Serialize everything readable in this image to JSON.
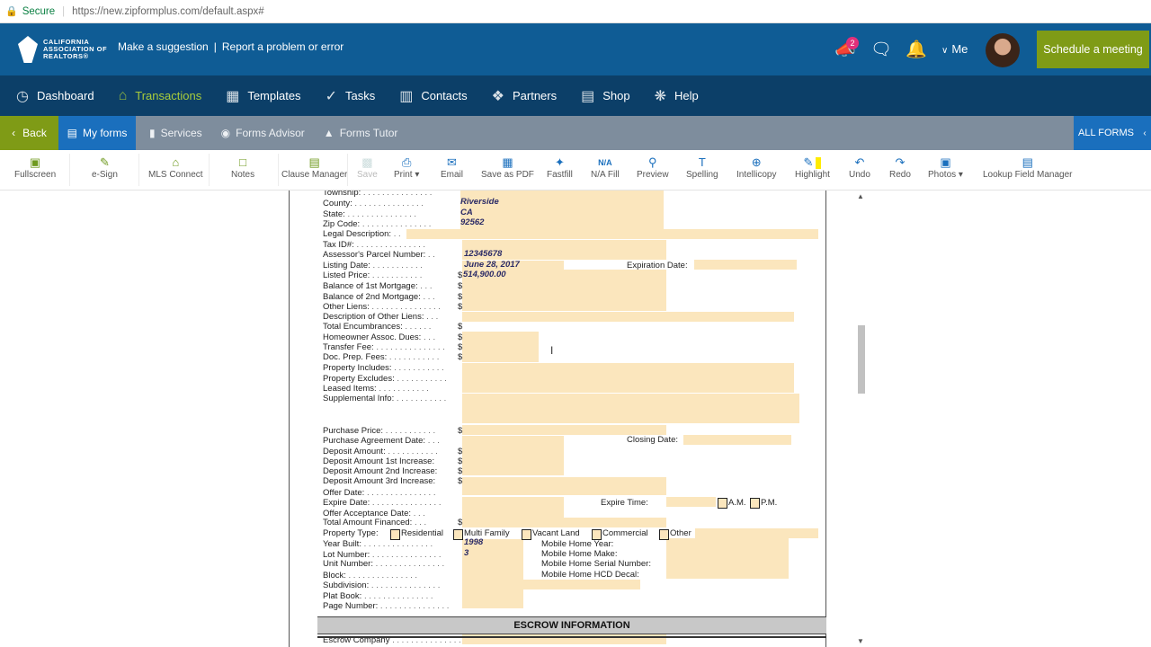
{
  "browser": {
    "secure_label": "Secure",
    "url": "https://new.zipformplus.com/default.aspx#"
  },
  "header": {
    "logo_text": "CALIFORNIA ASSOCIATION OF REALTORS®",
    "suggestion_link": "Make a suggestion",
    "separator": "|",
    "report_link": "Report a problem or error",
    "notification_count": "2",
    "me_label": "Me",
    "schedule_button": "Schedule a meeting"
  },
  "nav": {
    "items": [
      "Dashboard",
      "Transactions",
      "Templates",
      "Tasks",
      "Contacts",
      "Partners",
      "Shop",
      "Help"
    ],
    "active": "Transactions"
  },
  "subnav": {
    "back": "Back",
    "my_forms": "My forms",
    "services": "Services",
    "forms_advisor": "Forms Advisor",
    "forms_tutor": "Forms Tutor",
    "all_forms": "ALL FORMS"
  },
  "toolbar": {
    "fullscreen": "Fullscreen",
    "esign": "e-Sign",
    "mls_connect": "MLS Connect",
    "notes": "Notes",
    "clause_manager": "Clause Manager",
    "save": "Save",
    "print": "Print",
    "email": "Email",
    "save_pdf": "Save as PDF",
    "fastfill": "Fastfill",
    "na_fill": "N/A Fill",
    "preview": "Preview",
    "spelling": "Spelling",
    "intellicopy": "Intellicopy",
    "highlight": "Highlight",
    "undo": "Undo",
    "redo": "Redo",
    "photos": "Photos",
    "lookup": "Lookup Field Manager",
    "na_icon": "N/A"
  },
  "form": {
    "labels": {
      "township": "Township:",
      "county": "County:",
      "state": "State:",
      "zip": "Zip Code:",
      "legal": "Legal Description:",
      "tax_id": "Tax ID#:",
      "apn": "Assessor's Parcel Number:",
      "listing_date": "Listing Date:",
      "listed_price": "Listed Price:",
      "bal1": "Balance of 1st Mortgage:",
      "bal2": "Balance of 2nd Mortgage:",
      "other_liens": "Other Liens:",
      "desc_liens": "Description of Other Liens:",
      "total_enc": "Total Encumbrances:",
      "hoa": "Homeowner Assoc. Dues:",
      "transfer": "Transfer Fee:",
      "docprep": "Doc. Prep. Fees:",
      "includes": "Property Includes:",
      "excludes": "Property Excludes:",
      "leased": "Leased Items:",
      "supp": "Supplemental Info:",
      "purchase_price": "Purchase Price:",
      "pa_date": "Purchase Agreement Date:",
      "deposit": "Deposit Amount:",
      "dep1": "Deposit Amount 1st Increase:",
      "dep2": "Deposit Amount 2nd Increase:",
      "dep3": "Deposit Amount 3rd Increase:",
      "offer_date": "Offer Date:",
      "expire_date": "Expire Date:",
      "offer_acc": "Offer Acceptance Date:",
      "total_fin": "Total Amount Financed:",
      "prop_type": "Property Type:",
      "year_built": "Year Built:",
      "lot": "Lot Number:",
      "unit": "Unit Number:",
      "block": "Block:",
      "subdivision": "Subdivision:",
      "plat": "Plat Book:",
      "page_no": "Page Number:",
      "escrow_company": "Escrow Company",
      "expiration_date": "Expiration Date:",
      "closing_date": "Closing Date:",
      "expire_time": "Expire Time:",
      "am": "A.M.",
      "pm": "P.M.",
      "residential": "Residential",
      "multi": "Multi Family",
      "vacant": "Vacant Land",
      "commercial": "Commercial",
      "other": "Other",
      "mh_year": "Mobile Home Year:",
      "mh_make": "Mobile Home Make:",
      "mh_serial": "Mobile Home Serial Number:",
      "mh_hcd": "Mobile Home HCD Decal:"
    },
    "values": {
      "county": "Riverside",
      "state": "CA",
      "zip": "92562",
      "apn": "12345678",
      "listing_date": "June 28, 2017",
      "listed_price": "514,900.00",
      "year_built": "1998",
      "lot": "3"
    },
    "escrow_header": "ESCROW INFORMATION",
    "dollar": "$",
    "dots_long": ". . . . . . . . . . . . . . .",
    "dots_mid": ". . . . . . . . . . .",
    "dots_short": ". . . . . ."
  }
}
